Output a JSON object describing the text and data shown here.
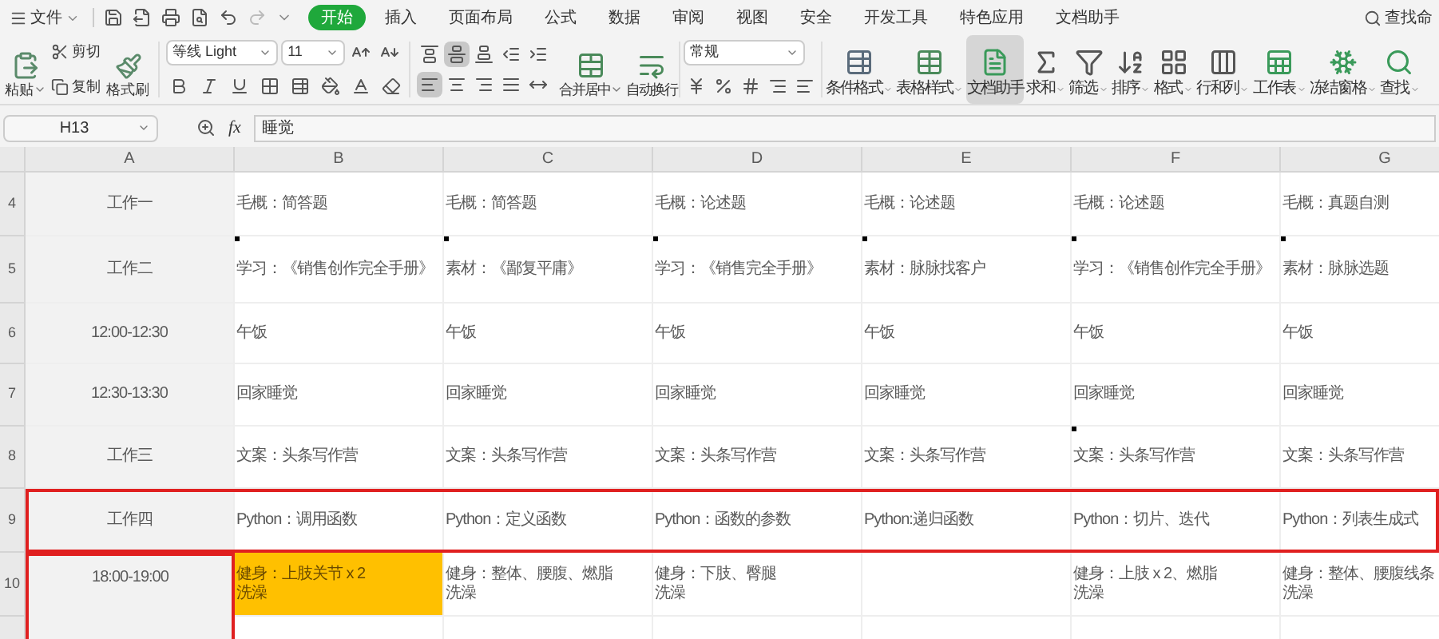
{
  "file_menu": {
    "label": "文件"
  },
  "menu_tabs": [
    {
      "label": "开始",
      "selected": true
    },
    {
      "label": "插入",
      "selected": false
    },
    {
      "label": "页面布局",
      "selected": false
    },
    {
      "label": "公式",
      "selected": false
    },
    {
      "label": "数据",
      "selected": false
    },
    {
      "label": "审阅",
      "selected": false
    },
    {
      "label": "视图",
      "selected": false
    },
    {
      "label": "安全",
      "selected": false
    },
    {
      "label": "开发工具",
      "selected": false
    },
    {
      "label": "特色应用",
      "selected": false
    },
    {
      "label": "文档助手",
      "selected": false
    }
  ],
  "search": {
    "label": "查找命"
  },
  "clipboard": {
    "paste": "粘贴",
    "cut": "剪切",
    "copy": "复制",
    "format_painter": "格式刷"
  },
  "font": {
    "name": "等线 Light",
    "size": "11"
  },
  "alignment_buttons": [
    {
      "selected": false
    },
    {
      "selected": true
    },
    {
      "selected": false
    },
    {
      "selected": false
    },
    {
      "selected": false
    },
    {
      "selected": true
    },
    {
      "selected": false
    },
    {
      "selected": false
    },
    {
      "selected": false
    },
    {
      "selected": false
    }
  ],
  "merge": {
    "merge_center": "合并居中",
    "wrap_text": "自动换行"
  },
  "number_format": {
    "value": "常规"
  },
  "ribbon_buttons": [
    {
      "label": "条件格式",
      "dropdown": true,
      "selected": false
    },
    {
      "label": "表格样式",
      "dropdown": true,
      "selected": false
    },
    {
      "label": "文档助手",
      "dropdown": false,
      "selected": true
    },
    {
      "label": "求和",
      "dropdown": true,
      "selected": false
    },
    {
      "label": "筛选",
      "dropdown": true,
      "selected": false
    },
    {
      "label": "排序",
      "dropdown": true,
      "selected": false
    },
    {
      "label": "格式",
      "dropdown": true,
      "selected": false
    },
    {
      "label": "行和列",
      "dropdown": true,
      "selected": false
    },
    {
      "label": "工作表",
      "dropdown": true,
      "selected": false
    },
    {
      "label": "冻结窗格",
      "dropdown": true,
      "selected": false
    },
    {
      "label": "查找",
      "dropdown": true,
      "selected": false
    }
  ],
  "formula_bar": {
    "name_box": "H13",
    "fx": "fx",
    "formula": "睡觉"
  },
  "columns": [
    "A",
    "B",
    "C",
    "D",
    "E",
    "F",
    "G"
  ],
  "rows": [
    {
      "number": "4",
      "outlined": false,
      "label_outlined": false,
      "cells": [
        {
          "lines": [
            "工作一"
          ],
          "comment": false,
          "highlighted": false
        },
        {
          "lines": [
            "毛概：简答题"
          ],
          "comment": false,
          "highlighted": false
        },
        {
          "lines": [
            "毛概：简答题"
          ],
          "comment": false,
          "highlighted": false
        },
        {
          "lines": [
            "毛概：论述题"
          ],
          "comment": false,
          "highlighted": false
        },
        {
          "lines": [
            "毛概：论述题"
          ],
          "comment": false,
          "highlighted": false
        },
        {
          "lines": [
            "毛概：论述题"
          ],
          "comment": false,
          "highlighted": false
        },
        {
          "lines": [
            "毛概：真题自测"
          ],
          "comment": false,
          "highlighted": false
        }
      ]
    },
    {
      "number": "5",
      "outlined": false,
      "label_outlined": false,
      "cells": [
        {
          "lines": [
            "工作二"
          ],
          "comment": false,
          "highlighted": false
        },
        {
          "lines": [
            "学习：《销售创作完全手册》"
          ],
          "comment": true,
          "highlighted": false
        },
        {
          "lines": [
            "素材：《鄙复平庸》"
          ],
          "comment": true,
          "highlighted": false
        },
        {
          "lines": [
            "学习：《销售完全手册》"
          ],
          "comment": true,
          "highlighted": false
        },
        {
          "lines": [
            "素材：脉脉找客户"
          ],
          "comment": true,
          "highlighted": false
        },
        {
          "lines": [
            "学习：《销售创作完全手册》"
          ],
          "comment": true,
          "highlighted": false
        },
        {
          "lines": [
            "素材：脉脉选题"
          ],
          "comment": true,
          "highlighted": false
        }
      ]
    },
    {
      "number": "6",
      "outlined": false,
      "label_outlined": false,
      "cells": [
        {
          "lines": [
            "12:00-12:30"
          ],
          "comment": false,
          "highlighted": false
        },
        {
          "lines": [
            "午饭"
          ],
          "comment": false,
          "highlighted": false
        },
        {
          "lines": [
            "午饭"
          ],
          "comment": false,
          "highlighted": false
        },
        {
          "lines": [
            "午饭"
          ],
          "comment": false,
          "highlighted": false
        },
        {
          "lines": [
            "午饭"
          ],
          "comment": false,
          "highlighted": false
        },
        {
          "lines": [
            "午饭"
          ],
          "comment": false,
          "highlighted": false
        },
        {
          "lines": [
            "午饭"
          ],
          "comment": false,
          "highlighted": false
        }
      ]
    },
    {
      "number": "7",
      "outlined": false,
      "label_outlined": false,
      "cells": [
        {
          "lines": [
            "12:30-13:30"
          ],
          "comment": false,
          "highlighted": false
        },
        {
          "lines": [
            "回家睡觉"
          ],
          "comment": false,
          "highlighted": false
        },
        {
          "lines": [
            "回家睡觉"
          ],
          "comment": false,
          "highlighted": false
        },
        {
          "lines": [
            "回家睡觉"
          ],
          "comment": false,
          "highlighted": false
        },
        {
          "lines": [
            "回家睡觉"
          ],
          "comment": false,
          "highlighted": false
        },
        {
          "lines": [
            "回家睡觉"
          ],
          "comment": false,
          "highlighted": false
        },
        {
          "lines": [
            "回家睡觉"
          ],
          "comment": false,
          "highlighted": false
        }
      ]
    },
    {
      "number": "8",
      "outlined": false,
      "label_outlined": false,
      "cells": [
        {
          "lines": [
            "工作三"
          ],
          "comment": false,
          "highlighted": false
        },
        {
          "lines": [
            "文案：头条写作营"
          ],
          "comment": false,
          "highlighted": false
        },
        {
          "lines": [
            "文案：头条写作营"
          ],
          "comment": false,
          "highlighted": false
        },
        {
          "lines": [
            "文案：头条写作营"
          ],
          "comment": false,
          "highlighted": false
        },
        {
          "lines": [
            "文案：头条写作营"
          ],
          "comment": false,
          "highlighted": false
        },
        {
          "lines": [
            "文案：头条写作营"
          ],
          "comment": true,
          "highlighted": false
        },
        {
          "lines": [
            "文案：头条写作营"
          ],
          "comment": false,
          "highlighted": false
        }
      ]
    },
    {
      "number": "9",
      "outlined": true,
      "label_outlined": false,
      "cells": [
        {
          "lines": [
            "工作四"
          ],
          "comment": false,
          "highlighted": false
        },
        {
          "lines": [
            "Python：调用函数"
          ],
          "comment": false,
          "highlighted": false
        },
        {
          "lines": [
            "Python：定义函数"
          ],
          "comment": false,
          "highlighted": false
        },
        {
          "lines": [
            "Python：函数的参数"
          ],
          "comment": false,
          "highlighted": false
        },
        {
          "lines": [
            "Python:递归函数"
          ],
          "comment": false,
          "highlighted": false
        },
        {
          "lines": [
            "Python：切片、迭代"
          ],
          "comment": false,
          "highlighted": false
        },
        {
          "lines": [
            "Python：列表生成式"
          ],
          "comment": false,
          "highlighted": false
        }
      ]
    },
    {
      "number": "10",
      "outlined": false,
      "label_outlined": true,
      "cells": [
        {
          "lines": [
            "18:00-19:00"
          ],
          "comment": false,
          "highlighted": false
        },
        {
          "lines": [
            "健身：上肢关节 x 2",
            "洗澡"
          ],
          "comment": false,
          "highlighted": true
        },
        {
          "lines": [
            "健身：整体、腰腹、燃脂",
            "洗澡"
          ],
          "comment": false,
          "highlighted": false
        },
        {
          "lines": [
            "健身：下肢、臀腿",
            "洗澡"
          ],
          "comment": false,
          "highlighted": false
        },
        {
          "comment": false,
          "highlighted": false
        },
        {
          "lines": [
            "健身：上肢 x 2、燃脂",
            "洗澡"
          ],
          "comment": false,
          "highlighted": false
        },
        {
          "lines": [
            "健身：整体、腰腹线条",
            "洗澡"
          ],
          "comment": false,
          "highlighted": false
        }
      ]
    },
    {
      "outlined": false,
      "label_outlined": true,
      "cells": [
        {
          "comment": false,
          "highlighted": false
        }
      ]
    }
  ]
}
